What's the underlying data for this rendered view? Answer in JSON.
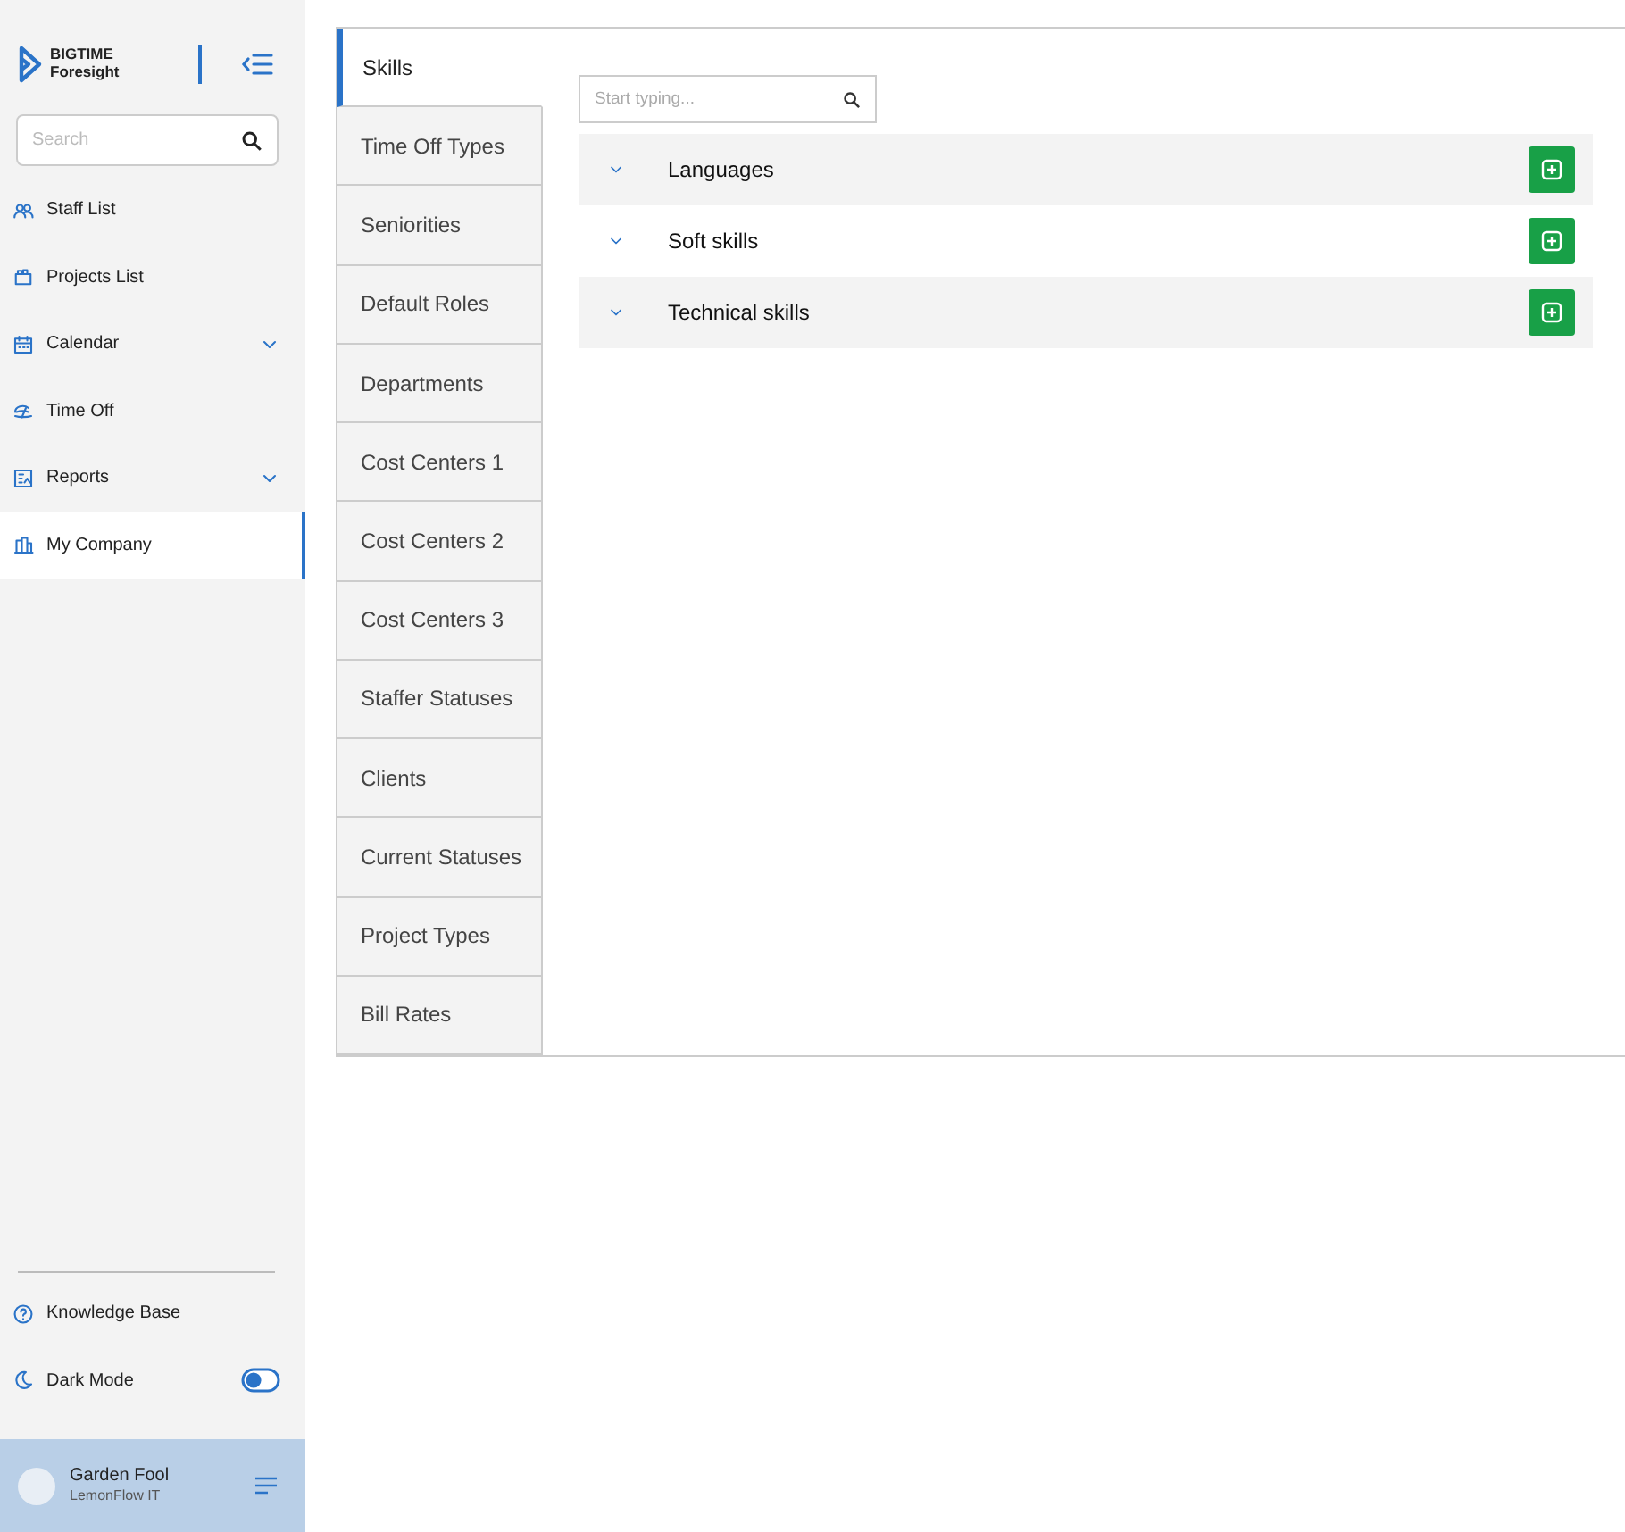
{
  "brand": {
    "line_1": "BIGTIME",
    "line_2": "Foresight"
  },
  "sidebar": {
    "search": {
      "placeholder": "Search"
    },
    "items": [
      {
        "label": "Staff List",
        "has_submenu": false,
        "selected": false
      },
      {
        "label": "Projects List",
        "has_submenu": false,
        "selected": false
      },
      {
        "label": "Calendar",
        "has_submenu": true,
        "selected": false
      },
      {
        "label": "Time Off",
        "has_submenu": false,
        "selected": false
      },
      {
        "label": "Reports",
        "has_submenu": true,
        "selected": false
      },
      {
        "label": "My Company",
        "has_submenu": false,
        "selected": true
      }
    ],
    "knowledge_base": "Knowledge Base",
    "dark_mode": {
      "label": "Dark Mode",
      "on": false
    },
    "user": {
      "name": "Garden Fool",
      "company": "LemonFlow IT"
    }
  },
  "tabs": [
    {
      "label": "Skills",
      "selected": true
    },
    {
      "label": "Time Off Types",
      "selected": false
    },
    {
      "label": "Seniorities",
      "selected": false
    },
    {
      "label": "Default Roles",
      "selected": false
    },
    {
      "label": "Departments",
      "selected": false
    },
    {
      "label": "Cost Centers 1",
      "selected": false
    },
    {
      "label": "Cost Centers 2",
      "selected": false
    },
    {
      "label": "Cost Centers 3",
      "selected": false
    },
    {
      "label": "Staffer Statuses",
      "selected": false
    },
    {
      "label": "Clients",
      "selected": false
    },
    {
      "label": "Current Statuses",
      "selected": false
    },
    {
      "label": "Project Types",
      "selected": false
    },
    {
      "label": "Bill Rates",
      "selected": false
    }
  ],
  "filter": {
    "placeholder": "Start typing..."
  },
  "groups": [
    {
      "label": "Languages",
      "expanded": false
    },
    {
      "label": "Soft skills",
      "expanded": false
    },
    {
      "label": "Technical skills",
      "expanded": false
    }
  ]
}
